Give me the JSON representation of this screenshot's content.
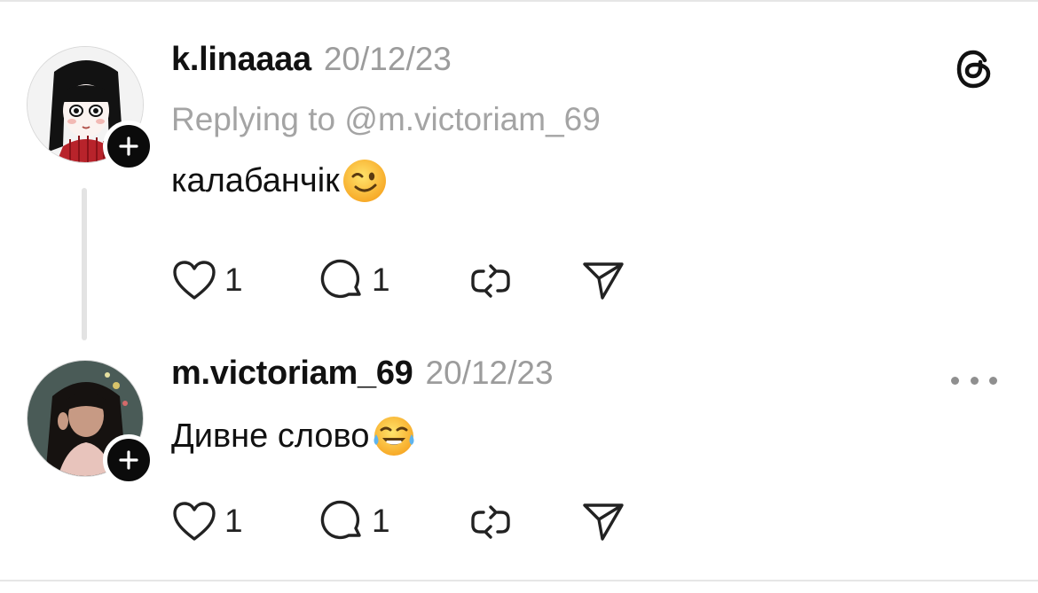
{
  "posts": [
    {
      "username": "k.linaaaa",
      "date": "20/12/23",
      "replying_to": "Replying to @m.victoriam_69",
      "text": "калабанчік",
      "emoji": "winking-face-emoji",
      "likes": "1",
      "replies": "1"
    },
    {
      "username": "m.victoriam_69",
      "date": "20/12/23",
      "text": "Дивне слово",
      "emoji": "tears-of-joy-emoji",
      "likes": "1",
      "replies": "1"
    }
  ],
  "icons": {
    "app_logo": "threads-logo-icon",
    "like": "heart-icon",
    "reply": "comment-icon",
    "repost": "repost-icon",
    "share": "send-icon",
    "more": "more-options-icon",
    "follow": "plus-icon"
  },
  "colors": {
    "text": "#111111",
    "muted": "#9c9c9c",
    "badge": "#0b0b0b"
  }
}
